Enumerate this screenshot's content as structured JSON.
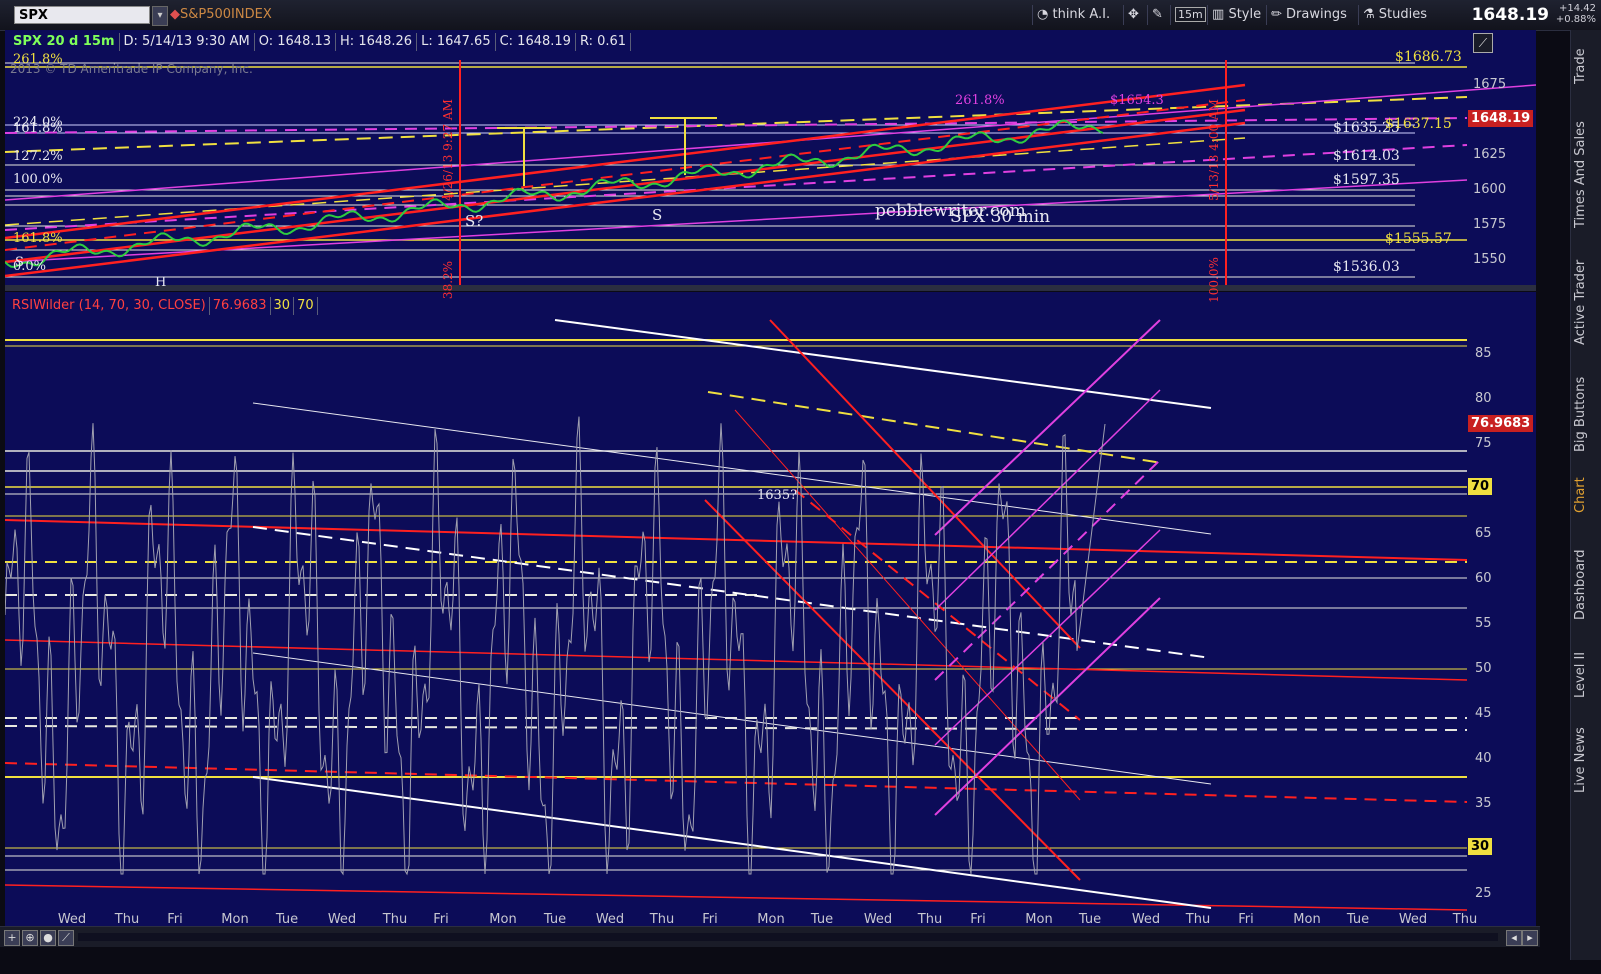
{
  "toolbar": {
    "symbol": "SPX",
    "symbol_name": "S&P500INDEX",
    "think_ai": "think A.I.",
    "interval": "15m",
    "style": "Style",
    "drawings": "Drawings",
    "studies": "Studies",
    "last_price": "1648.19",
    "change": "+14.42",
    "change_pct": "+0.88%"
  },
  "hud": {
    "symbol_period": "SPX 20 d 15m",
    "date": "D: 5/14/13 9:30 AM",
    "open": "O: 1648.13",
    "high": "H: 1648.26",
    "low": "L: 1647.65",
    "close": "C: 1648.19",
    "range": "R: 0.61",
    "copyright": "2013 © TD Ameritrade IP Company, Inc."
  },
  "price_panel": {
    "price_axis": [
      "1675",
      "1650",
      "1625",
      "1600",
      "1575",
      "1550"
    ],
    "current_price_tag": "1648.19",
    "fib_labels": [
      "261.8%",
      "224.0%",
      "161.8%",
      "127.2%",
      "100.0%",
      "161.8%",
      "0.0%"
    ],
    "level_labels": [
      "$1686.73",
      "$1635.25",
      "$1637.15",
      "$1614.03",
      "$1597.35",
      "$1555.57",
      "$1536.03"
    ],
    "annotations": [
      "261.8%",
      "$1654.3",
      "pebblewriter.com",
      "SPX 30 min",
      "S?",
      "S",
      "H",
      "S"
    ],
    "vertical_labels": [
      "4/26/13 9:27 AM",
      "5/13/13 4:00 AM",
      "38.2%",
      "100.0%"
    ]
  },
  "rsi_panel": {
    "study_label": "RSIWilder (14, 70, 30, CLOSE)",
    "value": "76.9683",
    "oversold": "30",
    "overbought": "70",
    "axis": [
      "85",
      "80",
      "75",
      "70",
      "65",
      "60",
      "55",
      "50",
      "45",
      "40",
      "35",
      "30",
      "25"
    ],
    "annotation": "1635?",
    "colors": {
      "overbought": "#ff3030",
      "neutral": "#a0a0b0",
      "oversold": "#40c0ff"
    }
  },
  "x_axis": [
    "Wed",
    "Thu",
    "Fri",
    "Mon",
    "Tue",
    "Wed",
    "Thu",
    "Fri",
    "Mon",
    "Tue",
    "Wed",
    "Thu",
    "Fri",
    "Mon",
    "Tue",
    "Wed",
    "Thu",
    "Fri",
    "Mon",
    "Tue",
    "Wed",
    "Thu",
    "Fri",
    "Mon",
    "Tue",
    "Wed",
    "Thu"
  ],
  "side_tabs": [
    "Trade",
    "Times And Sales",
    "Active Trader",
    "Big Buttons",
    "Chart",
    "Dashboard",
    "Level II",
    "Live News"
  ],
  "colors": {
    "background": "#0c0c58",
    "price_up": "#2ecc40",
    "accent": "#e0a030"
  }
}
